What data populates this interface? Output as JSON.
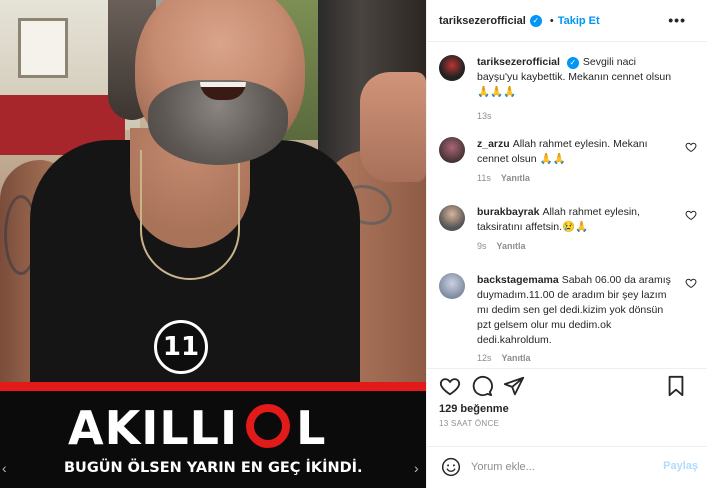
{
  "media": {
    "badge_number": "11",
    "banner_title_left": "AKILLI",
    "banner_title_right": "L",
    "banner_subtitle": "BUGÜN ÖLSEN YARIN EN GEÇ İKİNDİ."
  },
  "header": {
    "username": "tariksezerofficial",
    "separator": "•",
    "follow_label": "Takip Et",
    "more_label": "•••"
  },
  "caption": {
    "username": "tariksezerofficial",
    "text": "Sevgili naci bayşu'yu kaybettik. Mekanın cennet olsun 🙏🙏🙏",
    "time": "13s"
  },
  "comments": [
    {
      "username": "z_arzu",
      "text": "Allah rahmet eylesin. Mekanı cennet olsun 🙏🙏",
      "time": "11s",
      "reply_label": "Yanıtla"
    },
    {
      "username": "burakbayrak",
      "text": "Allah rahmet eylesin, taksiratını affetsin.😢🙏",
      "time": "9s",
      "reply_label": "Yanıtla"
    },
    {
      "username": "backstagemama",
      "text": "Sabah 06.00 da aramış duymadım.11.00 de aradım bir şey lazım mı dedim sen gel dedi.kizim yok dönsün pzt gelsem olur mu dedim.ok dedi.kahroldum.",
      "time": "12s",
      "reply_label": "Yanıtla"
    }
  ],
  "actions": {
    "likes": "129 beğenme",
    "time_ago": "13 SAAT ÖNCE"
  },
  "composer": {
    "placeholder": "Yorum ekle...",
    "post_label": "Paylaş"
  },
  "colors": {
    "accent": "#0095f6",
    "banner_red": "#e21a1a",
    "post_disabled": "#b3dbff"
  }
}
